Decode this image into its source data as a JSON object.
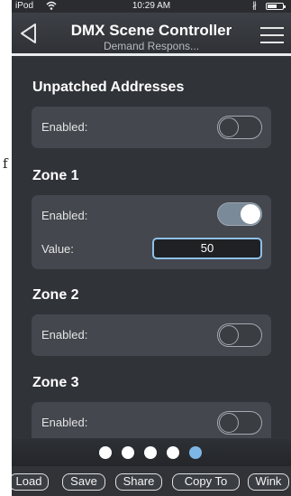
{
  "outside_text": "f",
  "status_bar": {
    "carrier": "iPod",
    "time": "10:29 AM"
  },
  "nav": {
    "title": "DMX Scene Controller",
    "subtitle": "Demand Respons...",
    "back_icon": "back-triangle-icon",
    "menu_icon": "hamburger-menu-icon"
  },
  "sections": [
    {
      "title": "Unpatched Addresses",
      "enabled_label": "Enabled:",
      "enabled": false
    },
    {
      "title": "Zone 1",
      "enabled_label": "Enabled:",
      "enabled": true,
      "value_label": "Value:",
      "value": "50"
    },
    {
      "title": "Zone 2",
      "enabled_label": "Enabled:",
      "enabled": false
    },
    {
      "title": "Zone 3",
      "enabled_label": "Enabled:",
      "enabled": false
    }
  ],
  "pager": {
    "page_count": 5,
    "active_page": 5
  },
  "toolbar": {
    "load": "Load",
    "save": "Save",
    "share": "Share",
    "copy_to": "Copy To",
    "wink": "Wink"
  },
  "colors": {
    "background": "#303338",
    "panel": "#44474d",
    "accent": "#7eb7e6"
  }
}
